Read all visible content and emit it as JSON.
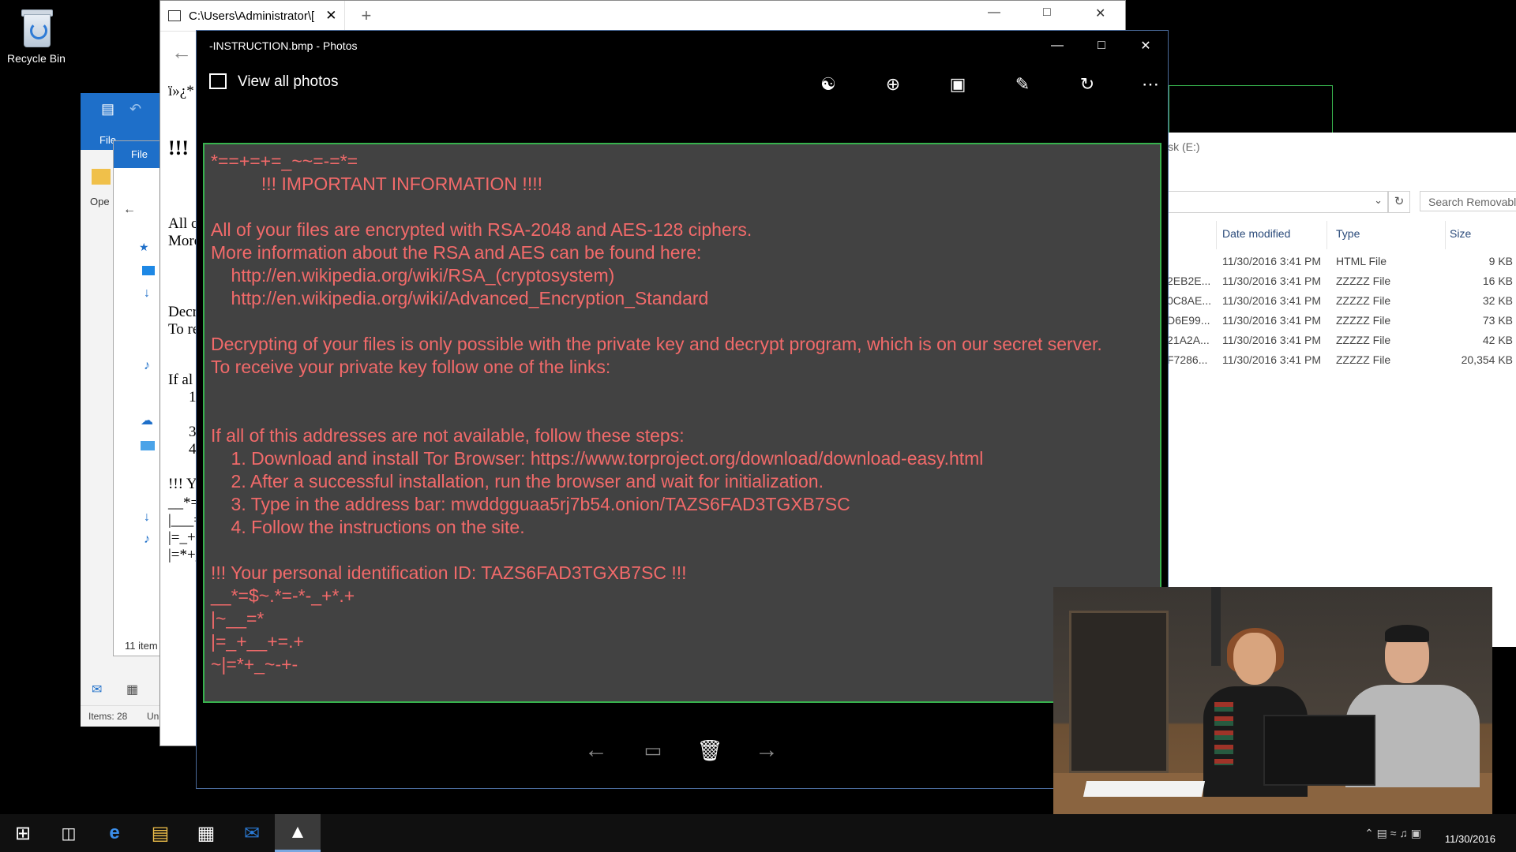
{
  "desktop": {
    "recycle_bin_label": "Recycle Bin"
  },
  "outlook": {
    "file_tab": "File",
    "status_items": "Items: 28",
    "status_un": "Un"
  },
  "explorer_small": {
    "file_tab": "File",
    "item_count": "11 item",
    "open_label": "Ope"
  },
  "notepad": {
    "title": "C:\\Users\\Administrator\\[",
    "lines": [
      "ï»¿*",
      "!!!",
      "All c",
      "More",
      "Decr",
      "To re",
      "If al",
      "1",
      "3",
      "4",
      "!!! Yo",
      "__*=",
      "|___=",
      "|=_+",
      "|=*+_"
    ]
  },
  "removable": {
    "title": "isk (E:)",
    "search_placeholder": "Search Removabl",
    "headers": [
      "Date modified",
      "Type",
      "Size"
    ],
    "rows": [
      {
        "name": "",
        "date": "11/30/2016 3:41 PM",
        "type": "HTML File",
        "size": "9 KB"
      },
      {
        "name": "2EB2E...",
        "date": "11/30/2016 3:41 PM",
        "type": "ZZZZZ File",
        "size": "16 KB"
      },
      {
        "name": "0C8AE...",
        "date": "11/30/2016 3:41 PM",
        "type": "ZZZZZ File",
        "size": "32 KB"
      },
      {
        "name": "D6E99...",
        "date": "11/30/2016 3:41 PM",
        "type": "ZZZZZ File",
        "size": "73 KB"
      },
      {
        "name": "21A2A...",
        "date": "11/30/2016 3:41 PM",
        "type": "ZZZZZ File",
        "size": "42 KB"
      },
      {
        "name": "F7286...",
        "date": "11/30/2016 3:41 PM",
        "type": "ZZZZZ File",
        "size": "20,354 KB"
      }
    ]
  },
  "photos": {
    "title": "-INSTRUCTION.bmp - Photos",
    "view_all": "View all photos",
    "message": [
      "*==+=+=_~~=-=*=",
      "          !!! IMPORTANT INFORMATION !!!!",
      "",
      "All of your files are encrypted with RSA-2048 and AES-128 ciphers.",
      "More information about the RSA and AES can be found here:",
      "    http://en.wikipedia.org/wiki/RSA_(cryptosystem)",
      "    http://en.wikipedia.org/wiki/Advanced_Encryption_Standard",
      "",
      "Decrypting of your files is only possible with the private key and decrypt program, which is on our secret server.",
      "To receive your private key follow one of the links:",
      "",
      "",
      "If all of this addresses are not available, follow these steps:",
      "    1. Download and install Tor Browser: https://www.torproject.org/download/download-easy.html",
      "    2. After a successful installation, run the browser and wait for initialization.",
      "    3. Type in the address bar: mwddgguaa5rj7b54.onion/TAZS6FAD3TGXB7SC",
      "    4. Follow the instructions on the site.",
      "",
      "!!! Your personal identification ID: TAZS6FAD3TGXB7SC !!!",
      "__*=$~.*=-*-_+*.+",
      "|~__=*",
      "|=_+__+=.+",
      "~|=*+_~-+-"
    ],
    "message_color": "#f26a6a",
    "frame_color": "#37b24d"
  },
  "taskbar": {
    "clock": "11/30/2016"
  }
}
